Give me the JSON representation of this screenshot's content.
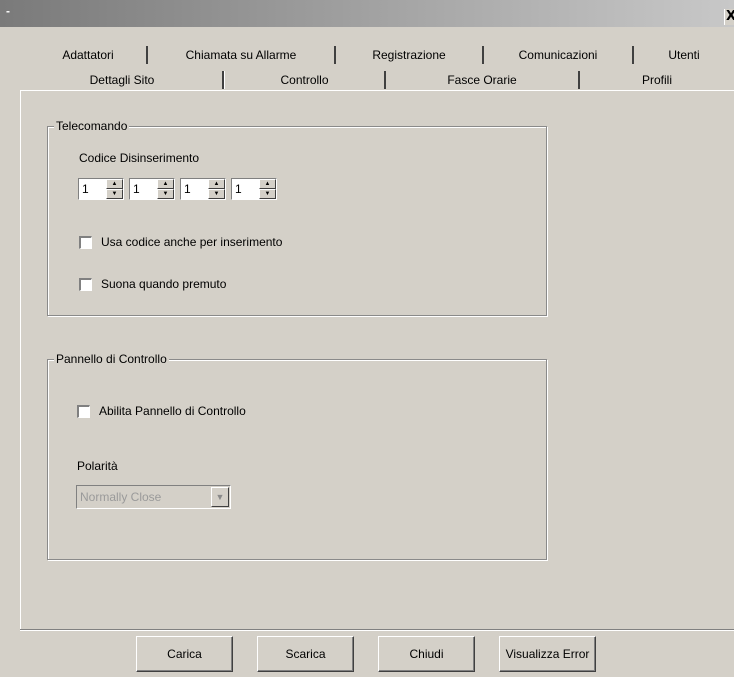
{
  "window": {
    "title": "-",
    "close_label": "X"
  },
  "tabs_row1": [
    "Adattatori",
    "Chiamata su Allarme",
    "Registrazione",
    "Comunicazioni",
    "Utenti"
  ],
  "tabs_row2": [
    "Dettagli Sito",
    "Controllo",
    "Fasce Orarie",
    "Profili"
  ],
  "active_tab": "Controllo",
  "telecomando": {
    "title": "Telecomando",
    "code_label": "Codice Disinserimento",
    "code_digits": [
      "1",
      "1",
      "1",
      "1"
    ],
    "use_code_label": "Usa codice anche per inserimento",
    "beep_label": "Suona quando premuto"
  },
  "pannello": {
    "title": "Pannello di Controllo",
    "enable_label": "Abilita Pannello di Controllo",
    "polarity_label": "Polarità",
    "polarity_value": "Normally Close"
  },
  "buttons": {
    "carica": "Carica",
    "scarica": "Scarica",
    "chiudi": "Chiudi",
    "visualizza": "Visualizza Error"
  }
}
